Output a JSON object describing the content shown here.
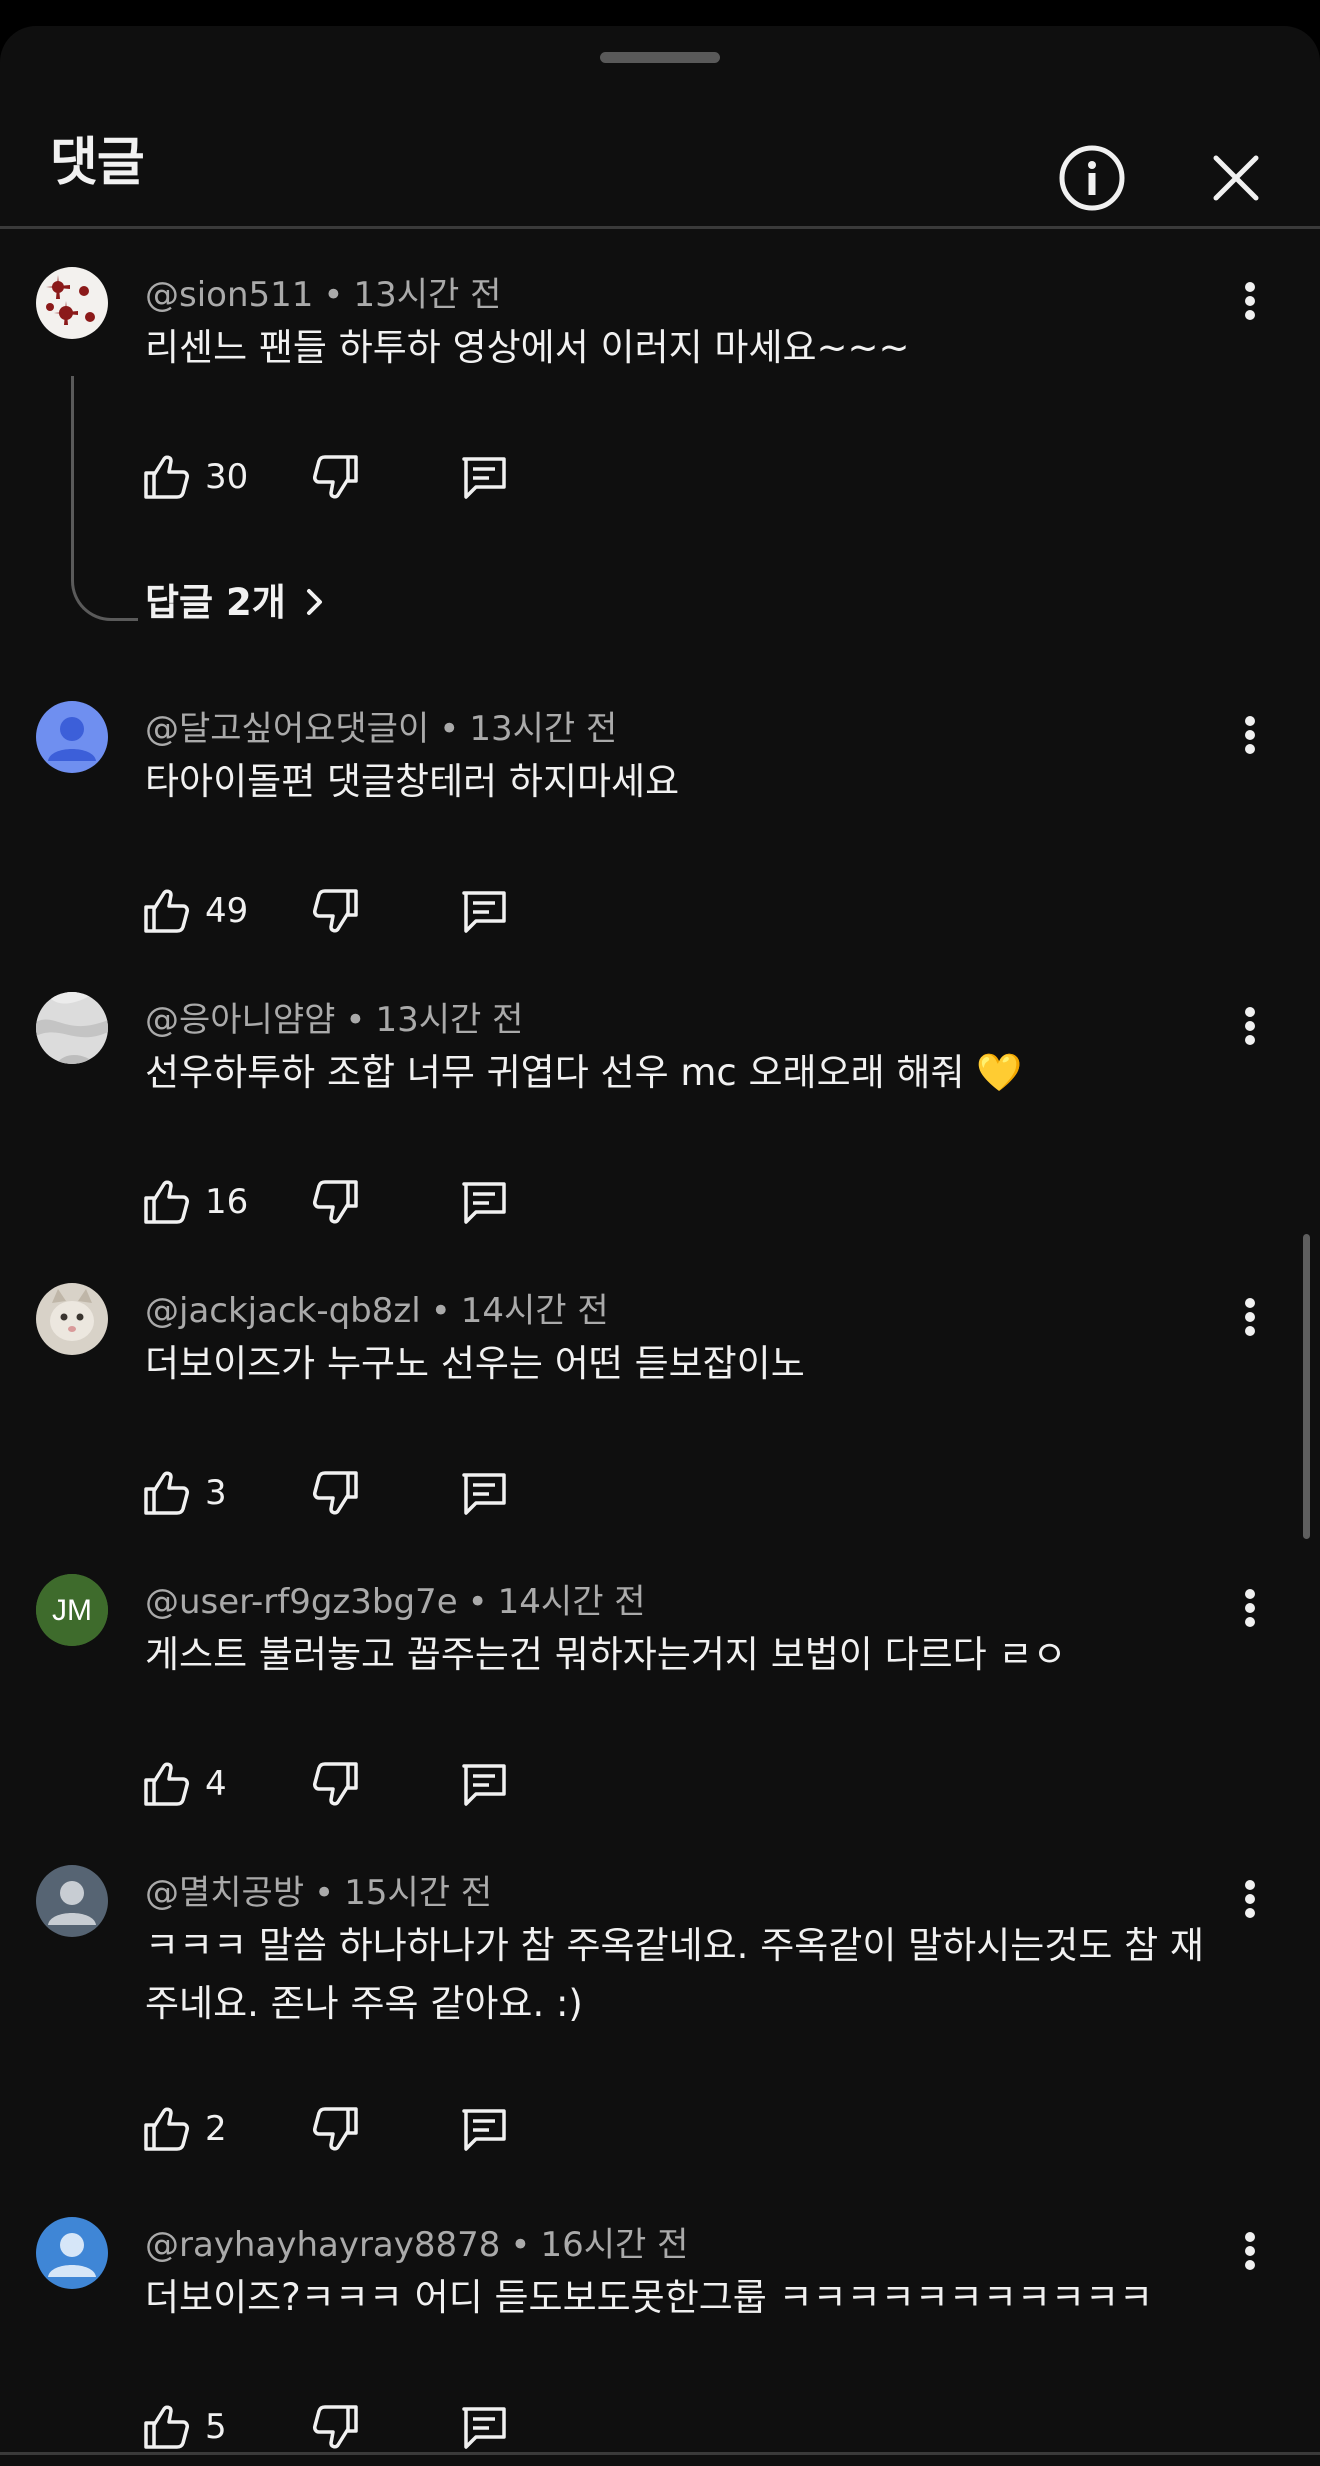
{
  "header": {
    "title": "댓글"
  },
  "comments": [
    {
      "author": "@sion511",
      "time": "13시간 전",
      "text": "리센느 팬들 하투하 영상에서 이러지 마세요~~~",
      "likes": "30",
      "replies": "답글 2개",
      "avatar_type": "pattern",
      "avatar_color": "#8b1a1a"
    },
    {
      "author": "@달고싶어요댓글이",
      "time": "13시간 전",
      "text": "타아이돌편 댓글창테러 하지마세요",
      "likes": "49",
      "avatar_type": "person",
      "avatar_color": "#6f8ff0"
    },
    {
      "author": "@응아니얌얌",
      "time": "13시간 전",
      "text": "선우하투하 조합 너무 귀엽다 선우 mc 오래오래 해줘 💛",
      "likes": "16",
      "avatar_type": "marble",
      "avatar_color": "#d9d9d9"
    },
    {
      "author": "@jackjack-qb8zl",
      "time": "14시간 전",
      "text": "더보이즈가 누구노 선우는 어떤 듣보잡이노",
      "likes": "3",
      "avatar_type": "cat",
      "avatar_color": "#d8d2c8"
    },
    {
      "author": "@user-rf9gz3bg7e",
      "time": "14시간 전",
      "text": "게스트 불러놓고 꼽주는건 뭐하자는거지 보법이 다르다 ㄹㅇ",
      "likes": "4",
      "avatar_type": "initials",
      "avatar_initials": "JM",
      "avatar_color": "#3e6b2c"
    },
    {
      "author": "@멸치공방",
      "time": "15시간 전",
      "text": "ㅋㅋㅋ 말씀 하나하나가 참 주옥같네요. 주옥같이 말하시는것도 참 재주네요. 존나 주옥 같아요. :)",
      "likes": "2",
      "avatar_type": "person",
      "avatar_color": "#566473"
    },
    {
      "author": "@rayhayhayray8878",
      "time": "16시간 전",
      "text": "더보이즈?ㅋㅋㅋ 어디 듣도보도못한그룹 ㅋㅋㅋㅋㅋㅋㅋㅋㅋㅋㅋ",
      "likes": "5",
      "avatar_type": "person",
      "avatar_color": "#3f86d6"
    }
  ],
  "icons": {
    "info": "info-icon",
    "close": "close-icon",
    "like": "thumbs-up-icon",
    "dislike": "thumbs-down-icon",
    "reply": "reply-icon",
    "more": "more-vertical-icon"
  }
}
